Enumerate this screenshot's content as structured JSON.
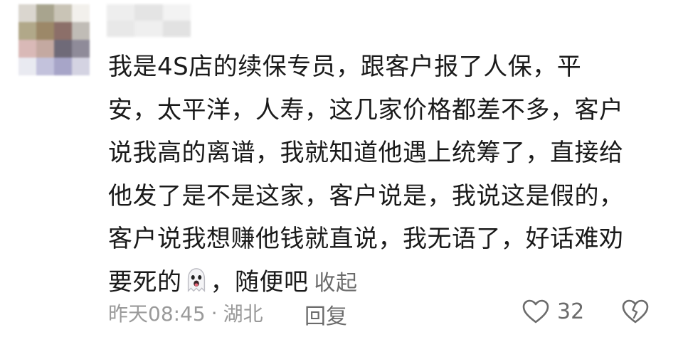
{
  "comment": {
    "avatar_colors": [
      "#dad6cf",
      "#a8a48e",
      "#c9c4b6",
      "#f2f0ec",
      "#b1a889",
      "#9c8868",
      "#8c6f69",
      "#c0bcb6",
      "#d9b9b7",
      "#c4a9a1",
      "#6f6a78",
      "#8f8b99",
      "#e9eaf1",
      "#c3c2dc",
      "#a7a5c8",
      "#d4d3e2"
    ],
    "username_blur_colors": [
      "#eeeeee",
      "#e4e4e4",
      "#f3f3f3",
      "#e8e8e8",
      "#efefef",
      "#e2e2e2"
    ],
    "text_lines": [
      "我是4S店的续保专员，跟客户报了人保，平",
      "安，太平洋，人寿，这几家价格都差不多，客户",
      "说我高的离谱，我就知道他遇上统筹了，直接给",
      "他发了是不是这家，客户说是，我说这是假的，",
      "客户说我想赚他钱就直说，我无语了，好话难劝"
    ],
    "last_line_prefix": "要死的",
    "emoji": "ghost-emoji",
    "last_line_suffix": "，随便吧",
    "collapse_label": "收起",
    "time": "昨天08:45",
    "separator": "·",
    "location": "湖北",
    "reply_label": "回复",
    "like_count": "32"
  }
}
